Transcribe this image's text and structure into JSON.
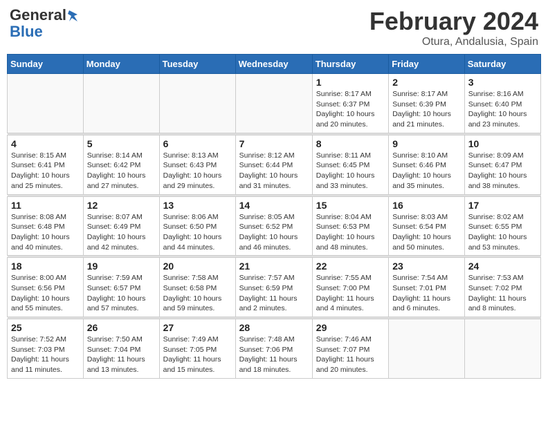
{
  "header": {
    "logo_line1": "General",
    "logo_line2": "Blue",
    "month_title": "February 2024",
    "location": "Otura, Andalusia, Spain"
  },
  "calendar": {
    "days_of_week": [
      "Sunday",
      "Monday",
      "Tuesday",
      "Wednesday",
      "Thursday",
      "Friday",
      "Saturday"
    ],
    "weeks": [
      [
        {
          "day": "",
          "info": ""
        },
        {
          "day": "",
          "info": ""
        },
        {
          "day": "",
          "info": ""
        },
        {
          "day": "",
          "info": ""
        },
        {
          "day": "1",
          "info": "Sunrise: 8:17 AM\nSunset: 6:37 PM\nDaylight: 10 hours\nand 20 minutes."
        },
        {
          "day": "2",
          "info": "Sunrise: 8:17 AM\nSunset: 6:39 PM\nDaylight: 10 hours\nand 21 minutes."
        },
        {
          "day": "3",
          "info": "Sunrise: 8:16 AM\nSunset: 6:40 PM\nDaylight: 10 hours\nand 23 minutes."
        }
      ],
      [
        {
          "day": "4",
          "info": "Sunrise: 8:15 AM\nSunset: 6:41 PM\nDaylight: 10 hours\nand 25 minutes."
        },
        {
          "day": "5",
          "info": "Sunrise: 8:14 AM\nSunset: 6:42 PM\nDaylight: 10 hours\nand 27 minutes."
        },
        {
          "day": "6",
          "info": "Sunrise: 8:13 AM\nSunset: 6:43 PM\nDaylight: 10 hours\nand 29 minutes."
        },
        {
          "day": "7",
          "info": "Sunrise: 8:12 AM\nSunset: 6:44 PM\nDaylight: 10 hours\nand 31 minutes."
        },
        {
          "day": "8",
          "info": "Sunrise: 8:11 AM\nSunset: 6:45 PM\nDaylight: 10 hours\nand 33 minutes."
        },
        {
          "day": "9",
          "info": "Sunrise: 8:10 AM\nSunset: 6:46 PM\nDaylight: 10 hours\nand 35 minutes."
        },
        {
          "day": "10",
          "info": "Sunrise: 8:09 AM\nSunset: 6:47 PM\nDaylight: 10 hours\nand 38 minutes."
        }
      ],
      [
        {
          "day": "11",
          "info": "Sunrise: 8:08 AM\nSunset: 6:48 PM\nDaylight: 10 hours\nand 40 minutes."
        },
        {
          "day": "12",
          "info": "Sunrise: 8:07 AM\nSunset: 6:49 PM\nDaylight: 10 hours\nand 42 minutes."
        },
        {
          "day": "13",
          "info": "Sunrise: 8:06 AM\nSunset: 6:50 PM\nDaylight: 10 hours\nand 44 minutes."
        },
        {
          "day": "14",
          "info": "Sunrise: 8:05 AM\nSunset: 6:52 PM\nDaylight: 10 hours\nand 46 minutes."
        },
        {
          "day": "15",
          "info": "Sunrise: 8:04 AM\nSunset: 6:53 PM\nDaylight: 10 hours\nand 48 minutes."
        },
        {
          "day": "16",
          "info": "Sunrise: 8:03 AM\nSunset: 6:54 PM\nDaylight: 10 hours\nand 50 minutes."
        },
        {
          "day": "17",
          "info": "Sunrise: 8:02 AM\nSunset: 6:55 PM\nDaylight: 10 hours\nand 53 minutes."
        }
      ],
      [
        {
          "day": "18",
          "info": "Sunrise: 8:00 AM\nSunset: 6:56 PM\nDaylight: 10 hours\nand 55 minutes."
        },
        {
          "day": "19",
          "info": "Sunrise: 7:59 AM\nSunset: 6:57 PM\nDaylight: 10 hours\nand 57 minutes."
        },
        {
          "day": "20",
          "info": "Sunrise: 7:58 AM\nSunset: 6:58 PM\nDaylight: 10 hours\nand 59 minutes."
        },
        {
          "day": "21",
          "info": "Sunrise: 7:57 AM\nSunset: 6:59 PM\nDaylight: 11 hours\nand 2 minutes."
        },
        {
          "day": "22",
          "info": "Sunrise: 7:55 AM\nSunset: 7:00 PM\nDaylight: 11 hours\nand 4 minutes."
        },
        {
          "day": "23",
          "info": "Sunrise: 7:54 AM\nSunset: 7:01 PM\nDaylight: 11 hours\nand 6 minutes."
        },
        {
          "day": "24",
          "info": "Sunrise: 7:53 AM\nSunset: 7:02 PM\nDaylight: 11 hours\nand 8 minutes."
        }
      ],
      [
        {
          "day": "25",
          "info": "Sunrise: 7:52 AM\nSunset: 7:03 PM\nDaylight: 11 hours\nand 11 minutes."
        },
        {
          "day": "26",
          "info": "Sunrise: 7:50 AM\nSunset: 7:04 PM\nDaylight: 11 hours\nand 13 minutes."
        },
        {
          "day": "27",
          "info": "Sunrise: 7:49 AM\nSunset: 7:05 PM\nDaylight: 11 hours\nand 15 minutes."
        },
        {
          "day": "28",
          "info": "Sunrise: 7:48 AM\nSunset: 7:06 PM\nDaylight: 11 hours\nand 18 minutes."
        },
        {
          "day": "29",
          "info": "Sunrise: 7:46 AM\nSunset: 7:07 PM\nDaylight: 11 hours\nand 20 minutes."
        },
        {
          "day": "",
          "info": ""
        },
        {
          "day": "",
          "info": ""
        }
      ]
    ]
  }
}
